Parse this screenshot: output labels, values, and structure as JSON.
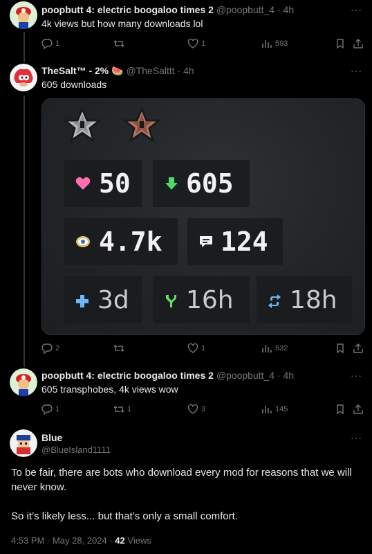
{
  "posts": [
    {
      "name": "poopbutt 4: electric boogaloo times 2",
      "handle": "@poopbutt_4",
      "time": "· 4h",
      "text": "4k views but how many downloads lol",
      "replies": "1",
      "reposts": "",
      "likes": "1",
      "views": "593"
    },
    {
      "name": "TheSalt™ - 2% 🍉",
      "handle": "@TheSalttt",
      "time": "· 4h",
      "text": "605 downloads",
      "replies": "2",
      "reposts": "",
      "likes": "1",
      "views": "532"
    },
    {
      "name": "poopbutt 4: electric boogaloo times 2",
      "handle": "@poopbutt_4",
      "time": "· 4h",
      "text": "605 transphobes, 4k views wow",
      "replies": "1",
      "reposts": "1",
      "likes": "3",
      "views": "145"
    }
  ],
  "stats_card": {
    "likes": "50",
    "downloads": "605",
    "views": "4.7k",
    "comments": "124",
    "created": "3d",
    "updated": "16h",
    "synced": "18h"
  },
  "main_post": {
    "name": "Blue",
    "handle": "@BlueIsland1111",
    "text_1": "To be fair, there are bots who download every mod for reasons that we will never know.",
    "text_2": "So it’s likely less... but that’s only a small comfort.",
    "timestamp": "4:53 PM · May 28, 2024 · ",
    "views_count": "42",
    "views_label": "Views"
  },
  "more_label": "···",
  "colors": {
    "background": "#000000",
    "secondary_text": "#71767b",
    "heart": "#ff6fb0",
    "arrow": "#4cd964"
  },
  "icons": [
    "reply-icon",
    "repost-icon",
    "like-icon",
    "views-icon",
    "bookmark-icon",
    "share-icon",
    "more-icon"
  ]
}
